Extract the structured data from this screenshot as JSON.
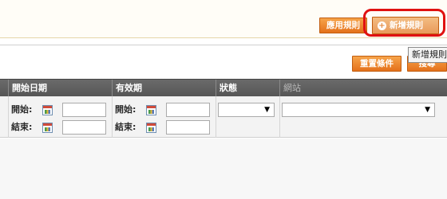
{
  "toolbar": {
    "apply_label": "應用規則",
    "add_label": "新增規則",
    "add_tooltip": "新增規則",
    "reset_label": "重置條件",
    "search_label": "搜尋"
  },
  "grid": {
    "columns": [
      {
        "label": "開始日期"
      },
      {
        "label": "有效期"
      },
      {
        "label": "狀態"
      },
      {
        "label": "網站"
      }
    ],
    "filters": {
      "start_date": {
        "from_label": "開始:",
        "to_label": "結束:",
        "from_value": "",
        "to_value": ""
      },
      "valid_until": {
        "from_label": "開始:",
        "to_label": "結束:",
        "from_value": "",
        "to_value": ""
      },
      "status": {
        "selected": ""
      },
      "website": {
        "selected": ""
      }
    }
  },
  "icons": {
    "add": "plus-circle-icon",
    "calendar": "calendar-icon",
    "dropdown": "chevron-down-icon"
  },
  "colors": {
    "button_orange": "#e4711b",
    "highlight_red": "#e01111",
    "header_gray": "#5f5f5f"
  }
}
